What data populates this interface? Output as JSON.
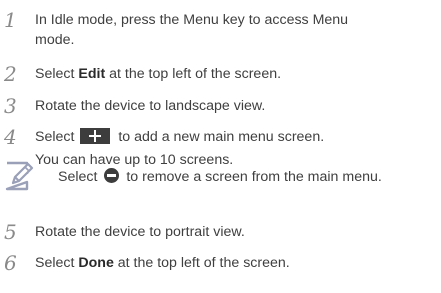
{
  "steps": [
    {
      "num": "1",
      "lines": [
        "In Idle mode, press the Menu key to access Menu",
        "mode."
      ]
    },
    {
      "num": "2",
      "pre": "Select ",
      "bold": "Edit",
      "post": " at the top left of the screen."
    },
    {
      "num": "3",
      "text": "Rotate the device to landscape view."
    },
    {
      "num": "4",
      "pre": "Select ",
      "post": " to add a new main menu screen.",
      "line2": "You can have up to 10 screens."
    },
    {
      "num": "5",
      "text": "Rotate the device to portrait view."
    },
    {
      "num": "6",
      "pre": "Select ",
      "bold": "Done",
      "post": " at the top left of the screen."
    }
  ],
  "note": {
    "pre": "Select ",
    "post": " to remove a screen from the main menu."
  },
  "icons": {
    "plus_button": "plus-button-icon",
    "minus_button": "minus-circle-icon",
    "note": "note-pencil-icon"
  }
}
